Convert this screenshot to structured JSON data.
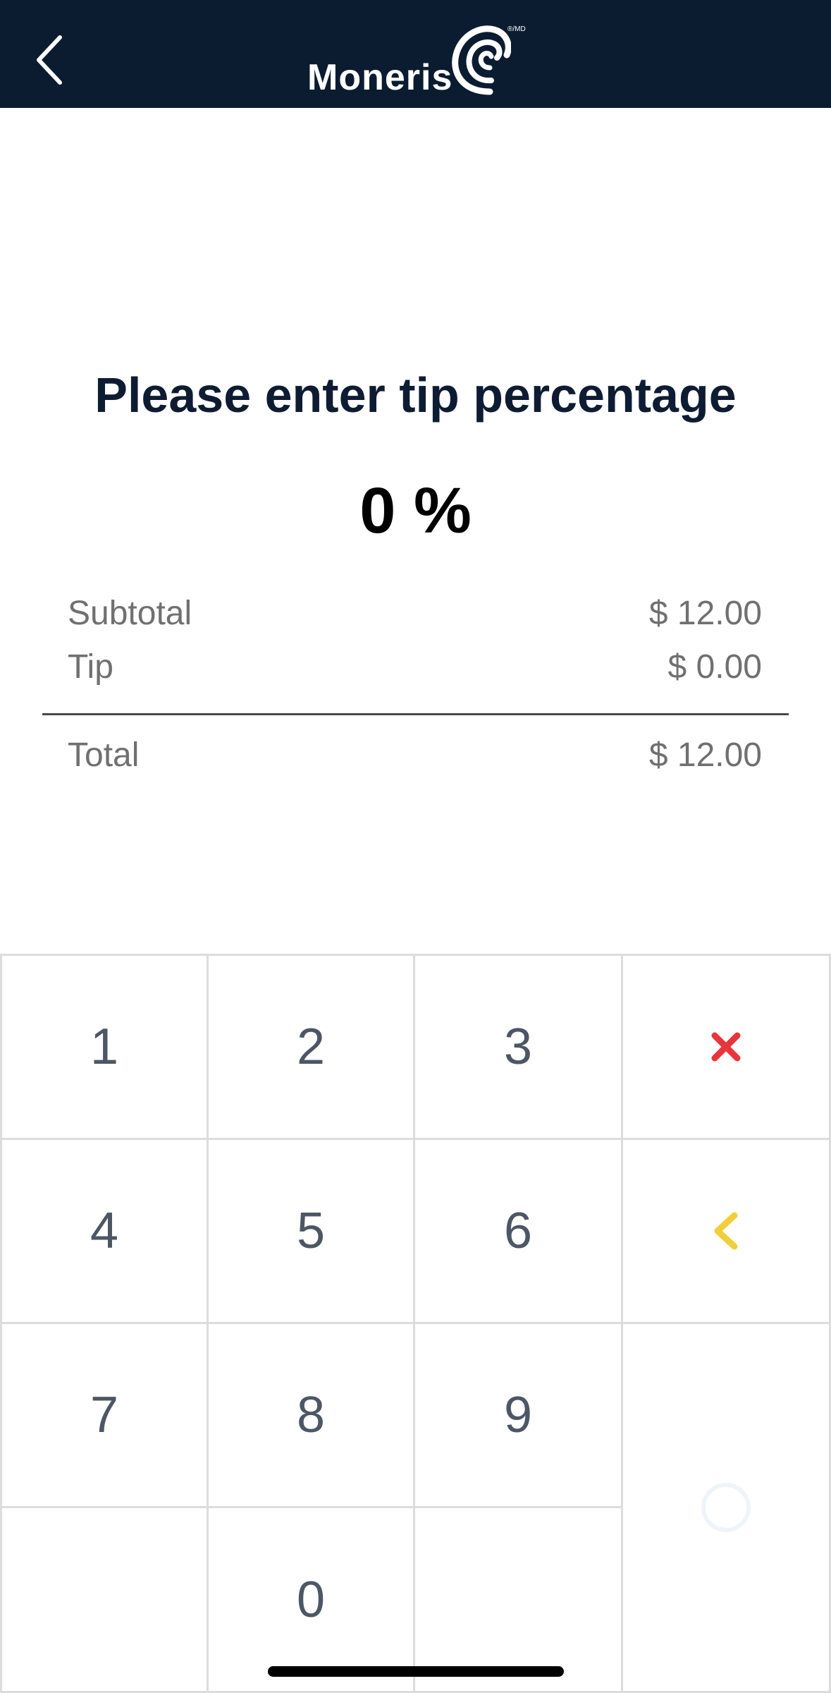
{
  "header": {
    "brand": "Moneris",
    "registered_mark": "®/MD",
    "back_icon": "chevron-left-icon",
    "background_color": "#0b1c31"
  },
  "main": {
    "title": "Please enter tip percentage",
    "tip_percent": "0 %",
    "summary": [
      {
        "label": "Subtotal",
        "value": "$ 12.00"
      },
      {
        "label": "Tip",
        "value": "$ 0.00"
      }
    ],
    "total": {
      "label": "Total",
      "value": "$ 12.00"
    }
  },
  "keypad": {
    "digits": [
      "1",
      "2",
      "3",
      "4",
      "5",
      "6",
      "7",
      "8",
      "9",
      "0"
    ],
    "clear_icon": "close-icon",
    "clear_color": "#e8353b",
    "backspace_icon": "chevron-left-icon",
    "backspace_color": "#f2cf3a",
    "confirm_icon": "circle-icon"
  }
}
